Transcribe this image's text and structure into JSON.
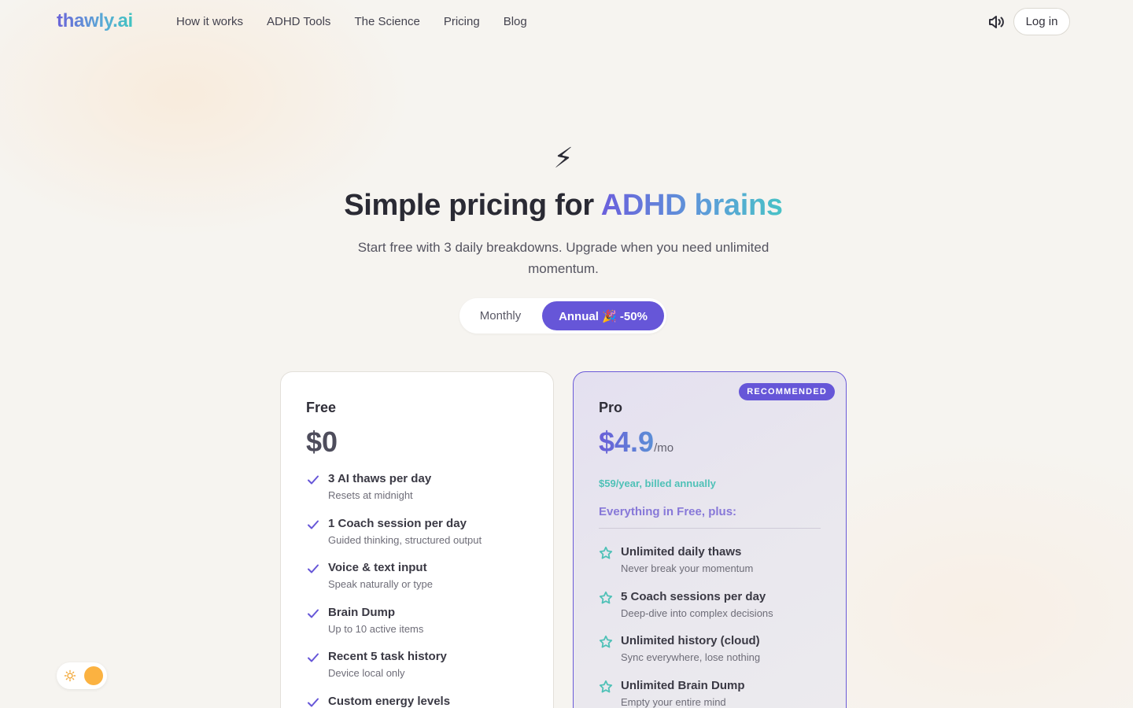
{
  "brand": {
    "logo_text": "thawly.ai",
    "accent": "#6656d8",
    "teal": "#4fc1b7"
  },
  "nav": {
    "links": [
      "How it works",
      "ADHD Tools",
      "The Science",
      "Pricing",
      "Blog"
    ],
    "sound_icon": "speaker-icon",
    "login_label": "Log in"
  },
  "hero": {
    "icon": "lightning-bolt-icon",
    "bolt": "⚡",
    "title_prefix": "Simple pricing for ",
    "title_highlight": "ADHD brains",
    "subtitle": "Start free with 3 daily breakdowns. Upgrade when you need unlimited momentum."
  },
  "billing_toggle": {
    "monthly_label": "Monthly",
    "annual_label": "Annual 🎉 -50%",
    "selected": "annual"
  },
  "plans": {
    "free": {
      "name": "Free",
      "price": "$0",
      "features": [
        {
          "title": "3 AI thaws per day",
          "desc": "Resets at midnight"
        },
        {
          "title": "1 Coach session per day",
          "desc": "Guided thinking, structured output"
        },
        {
          "title": "Voice & text input",
          "desc": "Speak naturally or type"
        },
        {
          "title": "Brain Dump",
          "desc": "Up to 10 active items"
        },
        {
          "title": "Recent 5 task history",
          "desc": "Device local only"
        },
        {
          "title": "Custom energy levels",
          "desc": ""
        }
      ]
    },
    "pro": {
      "badge": "RECOMMENDED",
      "name": "Pro",
      "price": "$4.9",
      "per": "/mo",
      "billing_note": "$59/year, billed annually",
      "plus_label": "Everything in Free, plus:",
      "features": [
        {
          "title": "Unlimited daily thaws",
          "desc": "Never break your momentum"
        },
        {
          "title": "5 Coach sessions per day",
          "desc": "Deep-dive into complex decisions"
        },
        {
          "title": "Unlimited history (cloud)",
          "desc": "Sync everywhere, lose nothing"
        },
        {
          "title": "Unlimited Brain Dump",
          "desc": "Empty your entire mind"
        }
      ]
    }
  },
  "theme_toggle": {
    "icon": "sun-icon",
    "mode": "light"
  }
}
